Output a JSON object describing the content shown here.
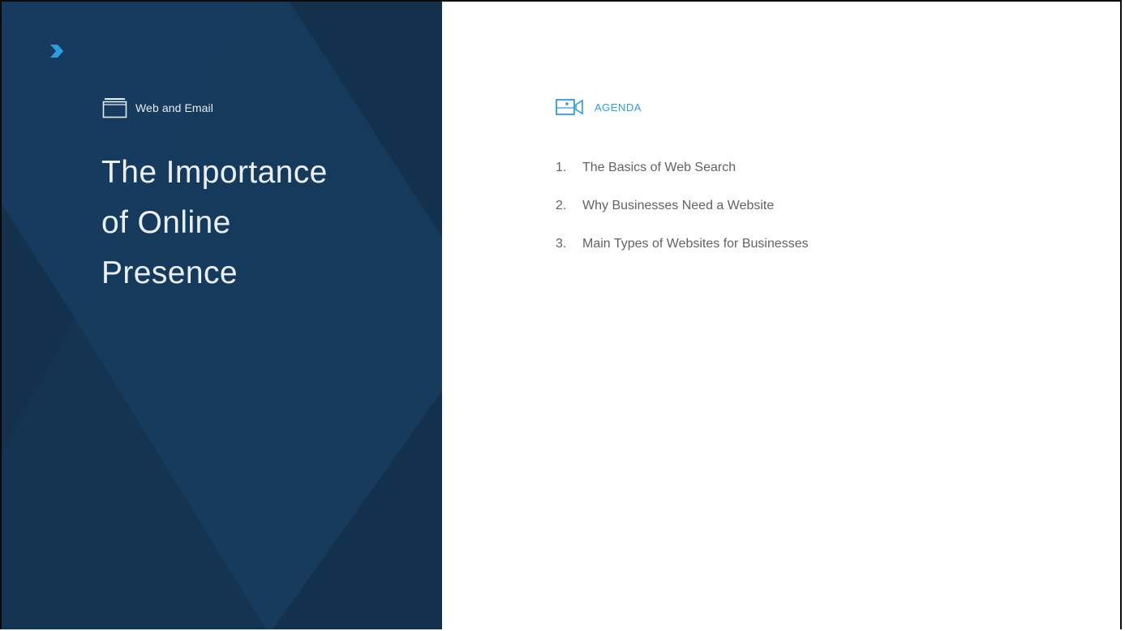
{
  "slide": {
    "section_label": "Web and Email",
    "title_lines": [
      "The Importance",
      "of Online",
      "Presence"
    ],
    "agenda_heading": "AGENDA",
    "agenda_items": [
      {
        "number": "1.",
        "text": "The Basics of Web Search"
      },
      {
        "number": "2.",
        "text": "Why Businesses Need a Website"
      },
      {
        "number": "3.",
        "text": "Main Types of Websites for Businesses"
      }
    ]
  },
  "icons": {
    "logo": "chevron-logo-icon",
    "section": "folder-icon",
    "agenda": "video-camera-icon"
  },
  "colors": {
    "panel_background": "#163a5c",
    "panel_shade": "#13304d",
    "panel_light": "#1a4469",
    "accent_blue": "#2e9be2",
    "title_text": "#e9eff5",
    "agenda_text": "#5f6368"
  }
}
